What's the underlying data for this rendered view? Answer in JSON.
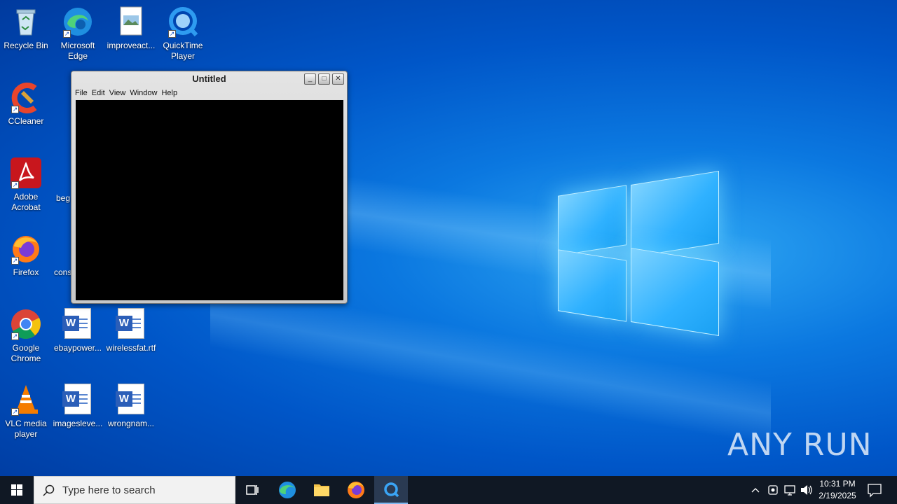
{
  "desktop_icons": [
    {
      "label": "Recycle Bin"
    },
    {
      "label": "Microsoft Edge"
    },
    {
      "label": "improveact..."
    },
    {
      "label": "QuickTime Player"
    },
    {
      "label": "CCleaner"
    },
    {
      "label": "Adobe Acrobat"
    },
    {
      "label": "beg"
    },
    {
      "label": "Firefox"
    },
    {
      "label": "cons"
    },
    {
      "label": "Google Chrome"
    },
    {
      "label": "ebaypower..."
    },
    {
      "label": "wirelessfat.rtf"
    },
    {
      "label": "VLC media player"
    },
    {
      "label": "imagesleve..."
    },
    {
      "label": "wrongnam..."
    }
  ],
  "qt_window": {
    "title": "Untitled",
    "menu": [
      "File",
      "Edit",
      "View",
      "Window",
      "Help"
    ]
  },
  "taskbar": {
    "search_placeholder": "Type here to search",
    "time": "10:31 PM",
    "date": "2/19/2025"
  },
  "watermark": "ANY RUN"
}
